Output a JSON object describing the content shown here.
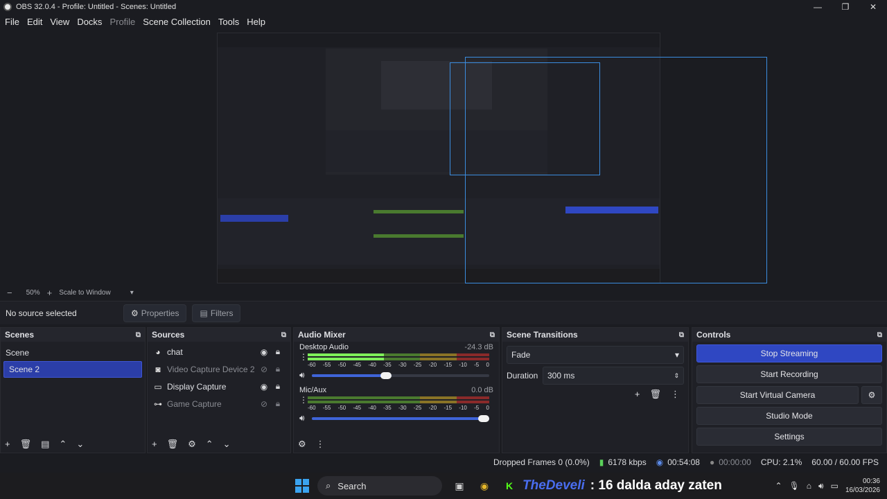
{
  "window": {
    "title": "OBS 32.0.4 - Profile: Untitled - Scenes: Untitled",
    "minimize": "—",
    "maximize": "❐",
    "close": "✕"
  },
  "menu": [
    "File",
    "Edit",
    "View",
    "Docks",
    "Profile",
    "Scene Collection",
    "Tools",
    "Help"
  ],
  "preview": {
    "zoom_minus": "−",
    "zoom": "50%",
    "zoom_plus": "+",
    "scale_mode": "Scale to Window"
  },
  "source_bar": {
    "no_source": "No source selected",
    "properties": "Properties",
    "filters": "Filters"
  },
  "scenes": {
    "title": "Scenes",
    "items": [
      "Scene",
      "Scene 2"
    ],
    "active_index": 1
  },
  "sources": {
    "title": "Sources",
    "items": [
      {
        "name": "chat",
        "icon": "browser-icon",
        "visible": true
      },
      {
        "name": "Video Capture Device 2",
        "icon": "camera-icon",
        "visible": false
      },
      {
        "name": "Display Capture",
        "icon": "monitor-icon",
        "visible": true
      },
      {
        "name": "Game Capture",
        "icon": "gamepad-icon",
        "visible": false
      }
    ]
  },
  "mixer": {
    "title": "Audio Mixer",
    "channels": [
      {
        "name": "Desktop Audio",
        "db": "-24.3 dB",
        "level": 0.42,
        "volume": 0.45
      },
      {
        "name": "Mic/Aux",
        "db": "0.0 dB",
        "level": 0.0,
        "volume": 1.0
      }
    ],
    "ticks": [
      "-60",
      "-55",
      "-50",
      "-45",
      "-40",
      "-35",
      "-30",
      "-25",
      "-20",
      "-15",
      "-10",
      "-5",
      "0"
    ]
  },
  "transitions": {
    "title": "Scene Transitions",
    "transition": "Fade",
    "duration_label": "Duration",
    "duration": "300 ms"
  },
  "controls": {
    "title": "Controls",
    "stop_streaming": "Stop Streaming",
    "start_recording": "Start Recording",
    "start_virtual_camera": "Start Virtual Camera",
    "studio_mode": "Studio Mode",
    "settings": "Settings"
  },
  "status": {
    "dropped": "Dropped Frames 0 (0.0%)",
    "kbps": "6178 kbps",
    "stream_time": "00:54:08",
    "rec_time": "00:00:00",
    "cpu": "CPU: 2.1%",
    "fps": "60.00 / 60.00 FPS"
  },
  "taskbar": {
    "search": "Search",
    "ticker_brand": "TheDeveli",
    "ticker_text": ": 16 dalda aday zaten",
    "time": "00:36",
    "date": "16/03/2026"
  }
}
